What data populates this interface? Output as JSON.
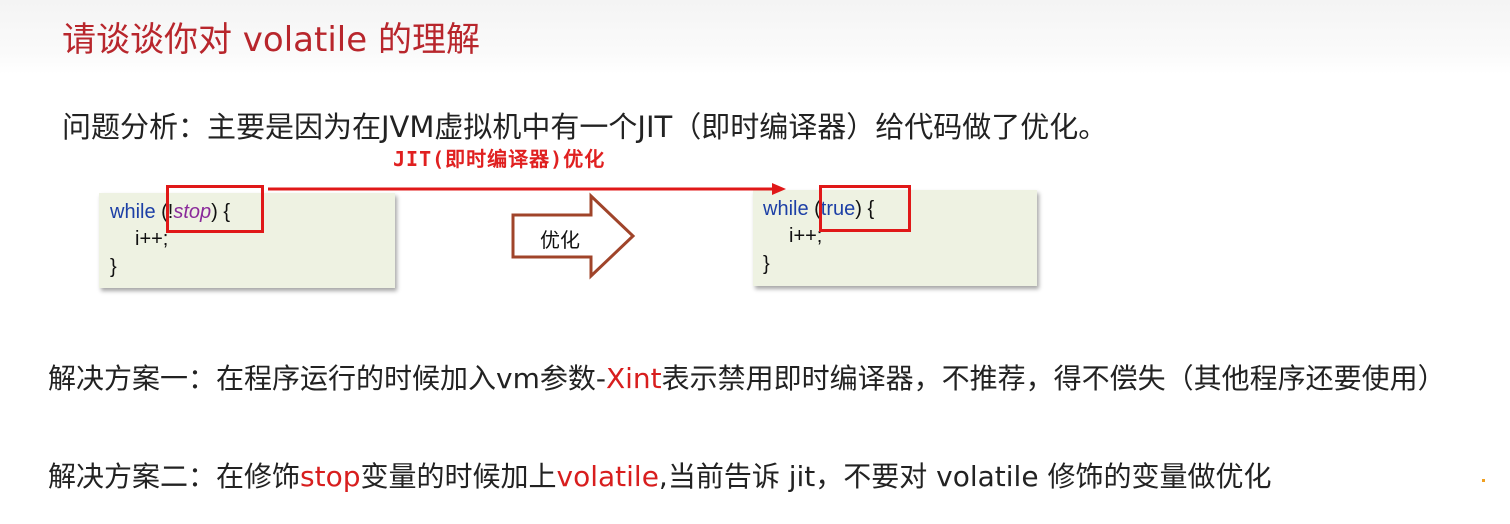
{
  "title": "请谈谈你对 volatile 的理解",
  "problem": {
    "text": "问题分析：主要是因为在JVM虚拟机中有一个JIT（即时编译器）给代码做了优化。"
  },
  "jit_note": "JIT(即时编译器)优化",
  "arrow_label": "优化",
  "code_before": {
    "kw_while": "while",
    "open_paren": " (!",
    "var": "stop",
    "close": ") {",
    "body": "i++;",
    "end": "}"
  },
  "code_after": {
    "kw_while": "while",
    "open_paren": " (",
    "kw_true": "true",
    "close": ") {",
    "body": "i++;",
    "end": "}"
  },
  "solution1": {
    "prefix": "解决方案一：在程序运行的时候加入vm参数-",
    "highlight": "Xint",
    "suffix": "表示禁用即时编译器，不推荐，得不偿失（其他程序还要使用）"
  },
  "solution2": {
    "prefix": "解决方案二：在修饰",
    "highlight1": "stop",
    "middle": "变量的时候加上",
    "highlight2": "volatile",
    "suffix": ",当前告诉 jit，不要对 volatile 修饰的变量做优化"
  },
  "colors": {
    "title": "#b8262c",
    "highlight": "#d81e1e",
    "arrow_line": "#e01818",
    "big_arrow_stroke": "#a0442a",
    "code_bg": "#eef2e2"
  }
}
